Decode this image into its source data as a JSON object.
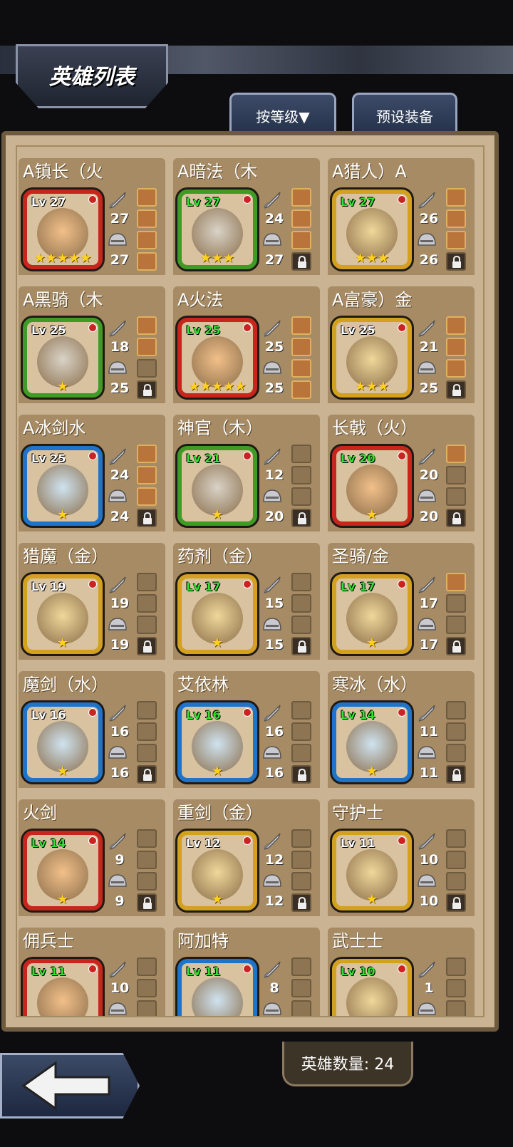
{
  "header": {
    "title": "英雄列表"
  },
  "tabs": {
    "sort_label": "按等级▼",
    "preset_label": "预设装备"
  },
  "footer": {
    "hero_count": "英雄数量: 24"
  },
  "icons": {
    "sword": "sword-icon",
    "helm": "helmet-icon",
    "lock": "lock-icon",
    "back": "back-arrow-icon"
  },
  "heroes": [
    {
      "name": "A镇长（火",
      "level": "Lv 27",
      "lv_color": "white",
      "element": "fire",
      "stars": "★★★★★",
      "atk": "27",
      "def": "27",
      "slots": [
        "filled",
        "filled",
        "filled",
        "filled"
      ]
    },
    {
      "name": "A暗法（木",
      "level": "Lv 27",
      "lv_color": "green",
      "element": "wood",
      "stars": "★★★",
      "atk": "24",
      "def": "27",
      "slots": [
        "filled",
        "filled",
        "filled",
        "lock"
      ]
    },
    {
      "name": "A猎人）A",
      "level": "Lv 27",
      "lv_color": "green",
      "element": "gold",
      "stars": "★★★",
      "atk": "26",
      "def": "26",
      "slots": [
        "filled",
        "filled",
        "filled",
        "lock"
      ]
    },
    {
      "name": "A黑骑（木",
      "level": "Lv 25",
      "lv_color": "white",
      "element": "wood",
      "stars": "★",
      "atk": "18",
      "def": "25",
      "slots": [
        "filled",
        "filled",
        "empty",
        "lock"
      ]
    },
    {
      "name": "A火法",
      "level": "Lv 25",
      "lv_color": "green",
      "element": "fire",
      "stars": "★★★★★",
      "atk": "25",
      "def": "25",
      "slots": [
        "filled",
        "filled",
        "filled",
        "filled"
      ]
    },
    {
      "name": "A富豪）金",
      "level": "Lv 25",
      "lv_color": "white",
      "element": "gold",
      "stars": "★★★",
      "atk": "21",
      "def": "25",
      "slots": [
        "filled",
        "filled",
        "filled",
        "lock"
      ]
    },
    {
      "name": "A冰剑水",
      "level": "Lv 25",
      "lv_color": "white",
      "element": "water",
      "stars": "★",
      "atk": "24",
      "def": "24",
      "slots": [
        "filled",
        "filled",
        "filled",
        "lock"
      ]
    },
    {
      "name": "神官（木）",
      "level": "Lv 21",
      "lv_color": "green",
      "element": "wood",
      "stars": "★",
      "atk": "12",
      "def": "20",
      "slots": [
        "empty",
        "empty",
        "empty",
        "lock"
      ]
    },
    {
      "name": "长戟（火）",
      "level": "Lv 20",
      "lv_color": "green",
      "element": "fire",
      "stars": "★",
      "atk": "20",
      "def": "20",
      "slots": [
        "filled",
        "empty",
        "empty",
        "lock"
      ]
    },
    {
      "name": "猎魔（金）",
      "level": "Lv 19",
      "lv_color": "white",
      "element": "gold",
      "stars": "★",
      "atk": "19",
      "def": "19",
      "slots": [
        "empty",
        "empty",
        "empty",
        "lock"
      ]
    },
    {
      "name": "药剂（金）",
      "level": "Lv 17",
      "lv_color": "green",
      "element": "gold",
      "stars": "★",
      "atk": "15",
      "def": "15",
      "slots": [
        "empty",
        "empty",
        "empty",
        "lock"
      ]
    },
    {
      "name": "圣骑/金",
      "level": "Lv 17",
      "lv_color": "green",
      "element": "gold",
      "stars": "★",
      "atk": "17",
      "def": "17",
      "slots": [
        "filled",
        "empty",
        "empty",
        "lock"
      ]
    },
    {
      "name": "魔剑（水）",
      "level": "Lv 16",
      "lv_color": "white",
      "element": "water",
      "stars": "★",
      "atk": "16",
      "def": "16",
      "slots": [
        "empty",
        "empty",
        "empty",
        "lock"
      ]
    },
    {
      "name": "艾依林",
      "level": "Lv 16",
      "lv_color": "green",
      "element": "water",
      "stars": "★",
      "atk": "16",
      "def": "16",
      "slots": [
        "empty",
        "empty",
        "empty",
        "lock"
      ]
    },
    {
      "name": "寒冰（水）",
      "level": "Lv 14",
      "lv_color": "green",
      "element": "water",
      "stars": "★",
      "atk": "11",
      "def": "11",
      "slots": [
        "empty",
        "empty",
        "empty",
        "lock"
      ]
    },
    {
      "name": "火剑",
      "level": "Lv 14",
      "lv_color": "green",
      "element": "fire",
      "stars": "★",
      "atk": "9",
      "def": "9",
      "slots": [
        "empty",
        "empty",
        "empty",
        "lock"
      ]
    },
    {
      "name": "重剑（金）",
      "level": "Lv 12",
      "lv_color": "white",
      "element": "gold",
      "stars": "★",
      "atk": "12",
      "def": "12",
      "slots": [
        "empty",
        "empty",
        "empty",
        "lock"
      ]
    },
    {
      "name": "守护士",
      "level": "Lv 11",
      "lv_color": "white",
      "element": "gold",
      "stars": "★",
      "atk": "10",
      "def": "10",
      "slots": [
        "empty",
        "empty",
        "empty",
        "lock"
      ]
    },
    {
      "name": "佣兵士",
      "level": "Lv 11",
      "lv_color": "green",
      "element": "fire",
      "stars": "★",
      "atk": "10",
      "def": "",
      "slots": [
        "empty",
        "empty",
        "empty",
        "lock"
      ]
    },
    {
      "name": "阿加特",
      "level": "Lv 11",
      "lv_color": "green",
      "element": "water",
      "stars": "★",
      "atk": "8",
      "def": "",
      "slots": [
        "empty",
        "empty",
        "empty",
        "lock"
      ]
    },
    {
      "name": "武士士",
      "level": "Lv 10",
      "lv_color": "green",
      "element": "gold",
      "stars": "★",
      "atk": "1",
      "def": "",
      "slots": [
        "empty",
        "empty",
        "empty",
        "lock"
      ]
    }
  ]
}
